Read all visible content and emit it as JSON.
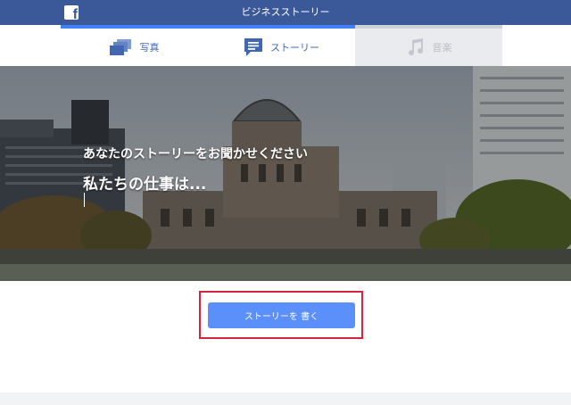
{
  "header": {
    "title": "ビジネスストーリー",
    "logo_glyph": "f",
    "bg_color": "#3b5998"
  },
  "tabs": [
    {
      "label": "写真",
      "icon": "photos-icon",
      "state": "inactive"
    },
    {
      "label": "ストーリー",
      "icon": "story-icon",
      "state": "active"
    },
    {
      "label": "音楽",
      "icon": "music-icon",
      "state": "disabled"
    }
  ],
  "hero": {
    "prompt": "あなたのストーリーをお聞かせください",
    "input_value": "私たちの仕事は..."
  },
  "actions": {
    "write_story_label": "ストーリーを 書く"
  },
  "colors": {
    "accent": "#4080ff",
    "button": "#5b8ff9",
    "highlight_border": "#d8233f"
  }
}
